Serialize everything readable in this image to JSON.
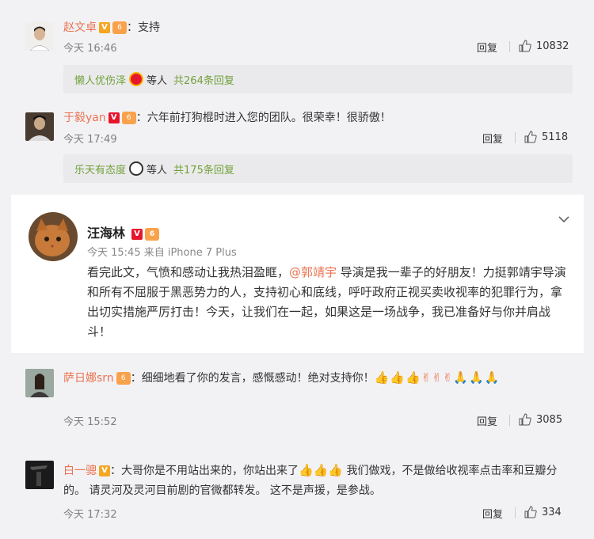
{
  "comment1": {
    "name": "赵文卓",
    "sep": "：",
    "text": "支持",
    "time": "今天 16:46",
    "reply": "回复",
    "likes": "10832"
  },
  "subbar1": {
    "who": "懒人优伤泽",
    "mid": "等人",
    "total": "共264条回复"
  },
  "comment2": {
    "name": "于毅yan",
    "sep": "：",
    "text": "六年前打狗棍时进入您的团队。很荣幸！很骄傲！",
    "time": "今天 17:49",
    "reply": "回复",
    "likes": "5118"
  },
  "subbar2": {
    "who": "乐天有态度",
    "mid": "等人",
    "total": "共175条回复"
  },
  "post": {
    "name": "汪海林",
    "meta": "今天 15:45 来自 iPhone 7 Plus",
    "body_pre": "看完此文，气愤和感动让我热泪盈眶，",
    "mention": "@郭靖宇",
    "body_post": " 导演是我一辈子的好朋友！力挺郭靖宇导演和所有不屈服于黑恶势力的人，支持初心和底线，呼吁政府正视买卖收视率的犯罪行为，拿出切实措施严厉打击！今天，让我们在一起，如果这是一场战争，我已准备好与你并肩战斗！"
  },
  "comment3": {
    "name": "萨日娜srn",
    "sep": "：",
    "text": "细细地看了你的发言，感慨感动！绝对支持你！",
    "emojis": "👍👍👍✌✌✌🙏🙏🙏",
    "time": "今天 15:52",
    "reply": "回复",
    "likes": "3085"
  },
  "comment4": {
    "name": "白一骢",
    "sep": "：",
    "text_pre": "大哥你是不用站出来的，你站出来了",
    "emojis": "👍👍👍",
    "text_post": " 我们做戏，不是做给收视率点击率和豆瓣分的。 请灵河及灵河目前剧的官微都转发。 这不是声援，是参战。",
    "time": "今天 17:32",
    "reply": "回复",
    "likes": "334"
  },
  "colors": {
    "name": "#eb7350",
    "green": "#72a13a",
    "meta": "#808080"
  }
}
